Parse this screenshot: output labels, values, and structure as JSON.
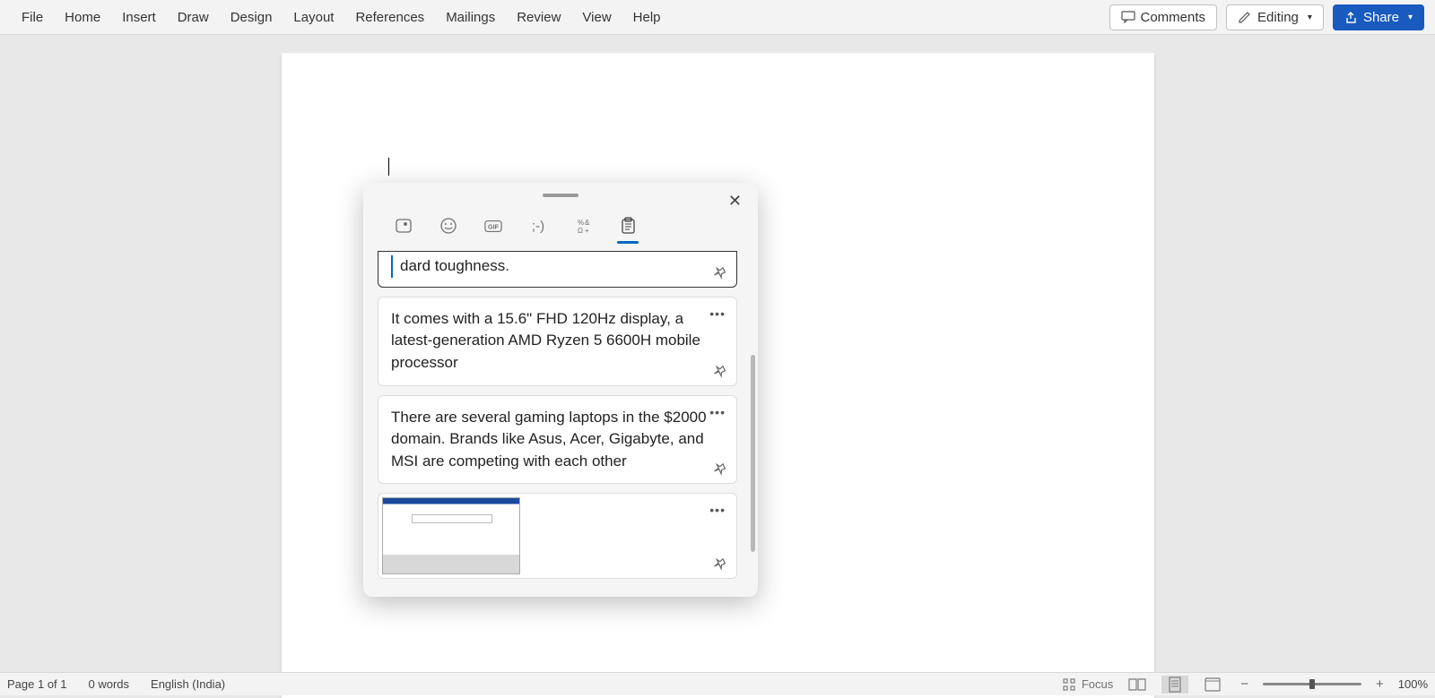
{
  "menu": {
    "items": [
      "File",
      "Home",
      "Insert",
      "Draw",
      "Design",
      "Layout",
      "References",
      "Mailings",
      "Review",
      "View",
      "Help"
    ]
  },
  "toolbar": {
    "comments_label": "Comments",
    "editing_label": "Editing",
    "share_label": "Share"
  },
  "panel": {
    "tabs": [
      "recent-icon",
      "emoji-icon",
      "gif-icon",
      "kaomoji-icon",
      "symbols-icon",
      "clipboard-icon"
    ],
    "clips": [
      {
        "text": "dard toughness."
      },
      {
        "text": " It comes with a 15.6\" FHD 120Hz display, a latest-generation AMD Ryzen 5 6600H mobile processor"
      },
      {
        "text": "There are several gaming laptops in the $2000 domain. Brands like Asus, Acer, Gigabyte, and MSI are competing with each other"
      }
    ]
  },
  "status": {
    "page_info": "Page 1 of 1",
    "word_count": "0 words",
    "language": "English (India)",
    "focus_label": "Focus",
    "zoom_minus": "−",
    "zoom_plus": "+",
    "zoom_percent": "100%"
  }
}
